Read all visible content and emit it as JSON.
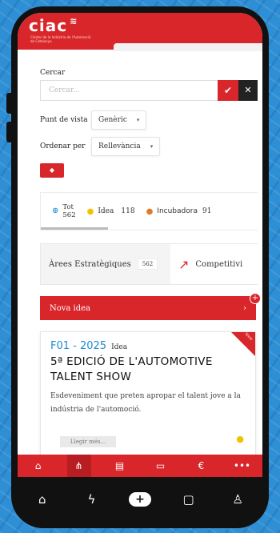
{
  "app": {
    "logo": "ciac",
    "logo_subtitle": "Clúster de la Indústria de l'Automoció de Catalunya"
  },
  "search": {
    "label": "Cercar",
    "placeholder": "Cercar..."
  },
  "filters": {
    "view_label": "Punt de vista",
    "view_value": "Genèric",
    "order_label": "Ordenar per",
    "order_value": "Rellevància"
  },
  "stats": {
    "total_label": "Tot",
    "total_count": "562",
    "idea_label": "Idea",
    "idea_count": "118",
    "incubator_label": "Incubadora",
    "incubator_count": "91"
  },
  "tabs": [
    {
      "label": "Àrees Estratègiques",
      "count": "562"
    },
    {
      "label": "Competitivi"
    }
  ],
  "new_idea": {
    "label": "Nova idea"
  },
  "card": {
    "ribbon": "New",
    "code": "F01 - 2025",
    "type": "Idea",
    "title": "5ª EDICIÓ DE L'AUTOMOTIVE TALENT SHOW",
    "description": "Esdeveniment que preten apropar el talent jove a la indústria de l'automoció.",
    "read_more": "Llegir més..."
  },
  "app_nav": [
    "home-icon",
    "network-icon",
    "store-icon",
    "id-card-icon",
    "euro-icon",
    "more-icon"
  ],
  "os_nav": [
    "home-icon",
    "bolt-icon",
    "plus-icon",
    "chat-icon",
    "user-icon"
  ],
  "colors": {
    "brand_red": "#d8262a",
    "accent_blue": "#1e8bd0",
    "background_blue": "#2f8fd4"
  }
}
